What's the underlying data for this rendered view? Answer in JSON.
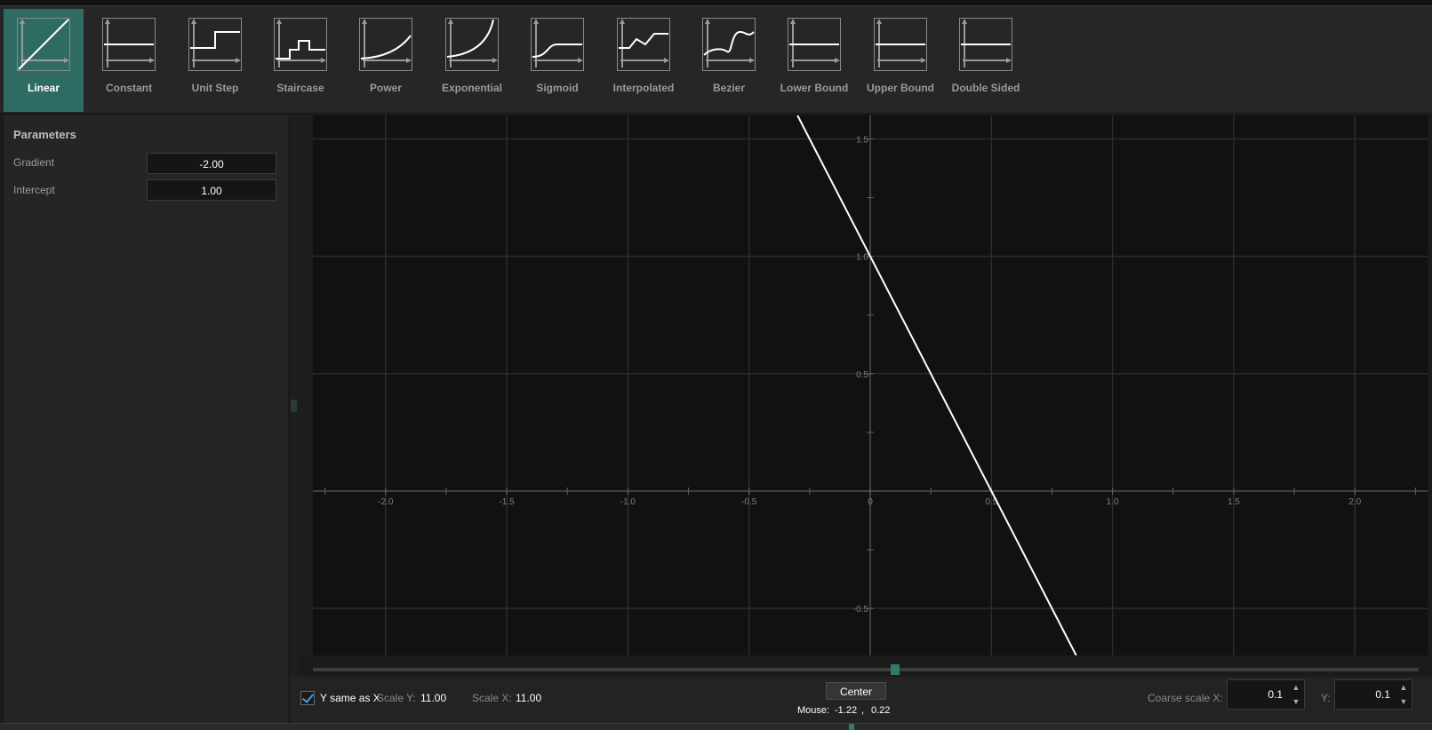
{
  "toolbar": {
    "tools": [
      {
        "label": "Linear",
        "icon": "linear-curve-icon"
      },
      {
        "label": "Constant",
        "icon": "constant-curve-icon"
      },
      {
        "label": "Unit Step",
        "icon": "unit-step-curve-icon"
      },
      {
        "label": "Staircase",
        "icon": "staircase-curve-icon"
      },
      {
        "label": "Power",
        "icon": "power-curve-icon"
      },
      {
        "label": "Exponential",
        "icon": "exponential-curve-icon"
      },
      {
        "label": "Sigmoid",
        "icon": "sigmoid-curve-icon"
      },
      {
        "label": "Interpolated",
        "icon": "interpolated-curve-icon"
      },
      {
        "label": "Bezier",
        "icon": "bezier-curve-icon"
      },
      {
        "label": "Lower Bound",
        "icon": "lower-bound-curve-icon"
      },
      {
        "label": "Upper Bound",
        "icon": "upper-bound-curve-icon"
      },
      {
        "label": "Double Sided",
        "icon": "double-sided-curve-icon"
      }
    ],
    "active": "Linear"
  },
  "parameters": {
    "title": "Parameters",
    "gradient": {
      "label": "Gradient",
      "value": "-2.00"
    },
    "intercept": {
      "label": "Intercept",
      "value": "1.00"
    }
  },
  "plot": {
    "x_range": [
      -2.3,
      2.3
    ],
    "y_range": [
      -0.7,
      1.6
    ],
    "x_ticks": [
      "-2.0",
      "-1.5",
      "-1.0",
      "-0.5",
      "0",
      "0.5",
      "1.0",
      "1.5",
      "2.0"
    ],
    "y_ticks": [
      "1.5",
      "1.0",
      "0.5",
      "-0.5"
    ],
    "line_color": "#ffffff",
    "background": "#111111"
  },
  "bottom": {
    "y_same_as_x": {
      "label": "Y same as X",
      "checked": true
    },
    "scale_y_label": "Scale Y:",
    "scale_y_value": "11.00",
    "scale_x_label": "Scale X:",
    "scale_x_value": "11.00",
    "center_label": "Center",
    "mouse_label": "Mouse:",
    "mouse_x": "-1.22",
    "mouse_sep": ",",
    "mouse_y": "0.22",
    "coarse_x_label": "Coarse scale X:",
    "coarse_x_value": "0.1",
    "coarse_y_label": "Y:",
    "coarse_y_value": "0.1"
  },
  "accent": "#2e6b63"
}
